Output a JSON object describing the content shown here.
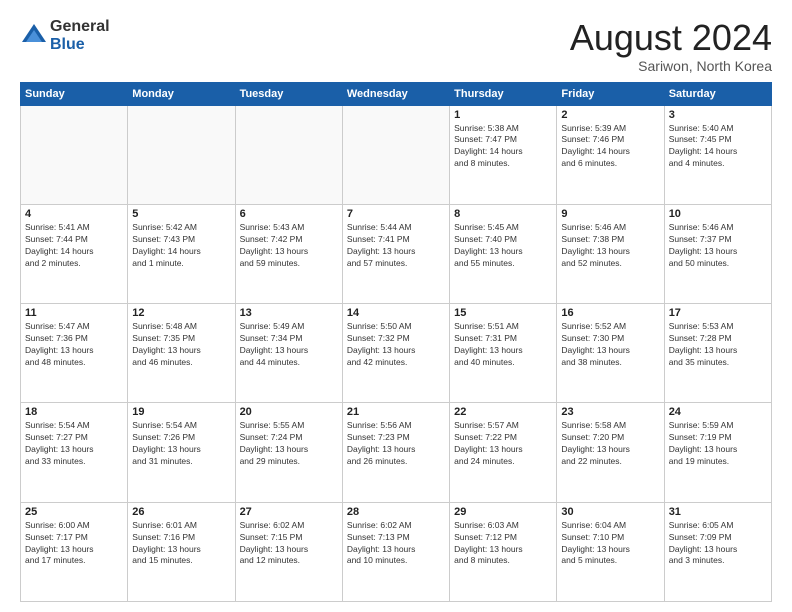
{
  "header": {
    "logo_general": "General",
    "logo_blue": "Blue",
    "month_title": "August 2024",
    "subtitle": "Sariwon, North Korea"
  },
  "days_of_week": [
    "Sunday",
    "Monday",
    "Tuesday",
    "Wednesday",
    "Thursday",
    "Friday",
    "Saturday"
  ],
  "weeks": [
    [
      {
        "day": "",
        "content": ""
      },
      {
        "day": "",
        "content": ""
      },
      {
        "day": "",
        "content": ""
      },
      {
        "day": "",
        "content": ""
      },
      {
        "day": "1",
        "content": "Sunrise: 5:38 AM\nSunset: 7:47 PM\nDaylight: 14 hours\nand 8 minutes."
      },
      {
        "day": "2",
        "content": "Sunrise: 5:39 AM\nSunset: 7:46 PM\nDaylight: 14 hours\nand 6 minutes."
      },
      {
        "day": "3",
        "content": "Sunrise: 5:40 AM\nSunset: 7:45 PM\nDaylight: 14 hours\nand 4 minutes."
      }
    ],
    [
      {
        "day": "4",
        "content": "Sunrise: 5:41 AM\nSunset: 7:44 PM\nDaylight: 14 hours\nand 2 minutes."
      },
      {
        "day": "5",
        "content": "Sunrise: 5:42 AM\nSunset: 7:43 PM\nDaylight: 14 hours\nand 1 minute."
      },
      {
        "day": "6",
        "content": "Sunrise: 5:43 AM\nSunset: 7:42 PM\nDaylight: 13 hours\nand 59 minutes."
      },
      {
        "day": "7",
        "content": "Sunrise: 5:44 AM\nSunset: 7:41 PM\nDaylight: 13 hours\nand 57 minutes."
      },
      {
        "day": "8",
        "content": "Sunrise: 5:45 AM\nSunset: 7:40 PM\nDaylight: 13 hours\nand 55 minutes."
      },
      {
        "day": "9",
        "content": "Sunrise: 5:46 AM\nSunset: 7:38 PM\nDaylight: 13 hours\nand 52 minutes."
      },
      {
        "day": "10",
        "content": "Sunrise: 5:46 AM\nSunset: 7:37 PM\nDaylight: 13 hours\nand 50 minutes."
      }
    ],
    [
      {
        "day": "11",
        "content": "Sunrise: 5:47 AM\nSunset: 7:36 PM\nDaylight: 13 hours\nand 48 minutes."
      },
      {
        "day": "12",
        "content": "Sunrise: 5:48 AM\nSunset: 7:35 PM\nDaylight: 13 hours\nand 46 minutes."
      },
      {
        "day": "13",
        "content": "Sunrise: 5:49 AM\nSunset: 7:34 PM\nDaylight: 13 hours\nand 44 minutes."
      },
      {
        "day": "14",
        "content": "Sunrise: 5:50 AM\nSunset: 7:32 PM\nDaylight: 13 hours\nand 42 minutes."
      },
      {
        "day": "15",
        "content": "Sunrise: 5:51 AM\nSunset: 7:31 PM\nDaylight: 13 hours\nand 40 minutes."
      },
      {
        "day": "16",
        "content": "Sunrise: 5:52 AM\nSunset: 7:30 PM\nDaylight: 13 hours\nand 38 minutes."
      },
      {
        "day": "17",
        "content": "Sunrise: 5:53 AM\nSunset: 7:28 PM\nDaylight: 13 hours\nand 35 minutes."
      }
    ],
    [
      {
        "day": "18",
        "content": "Sunrise: 5:54 AM\nSunset: 7:27 PM\nDaylight: 13 hours\nand 33 minutes."
      },
      {
        "day": "19",
        "content": "Sunrise: 5:54 AM\nSunset: 7:26 PM\nDaylight: 13 hours\nand 31 minutes."
      },
      {
        "day": "20",
        "content": "Sunrise: 5:55 AM\nSunset: 7:24 PM\nDaylight: 13 hours\nand 29 minutes."
      },
      {
        "day": "21",
        "content": "Sunrise: 5:56 AM\nSunset: 7:23 PM\nDaylight: 13 hours\nand 26 minutes."
      },
      {
        "day": "22",
        "content": "Sunrise: 5:57 AM\nSunset: 7:22 PM\nDaylight: 13 hours\nand 24 minutes."
      },
      {
        "day": "23",
        "content": "Sunrise: 5:58 AM\nSunset: 7:20 PM\nDaylight: 13 hours\nand 22 minutes."
      },
      {
        "day": "24",
        "content": "Sunrise: 5:59 AM\nSunset: 7:19 PM\nDaylight: 13 hours\nand 19 minutes."
      }
    ],
    [
      {
        "day": "25",
        "content": "Sunrise: 6:00 AM\nSunset: 7:17 PM\nDaylight: 13 hours\nand 17 minutes."
      },
      {
        "day": "26",
        "content": "Sunrise: 6:01 AM\nSunset: 7:16 PM\nDaylight: 13 hours\nand 15 minutes."
      },
      {
        "day": "27",
        "content": "Sunrise: 6:02 AM\nSunset: 7:15 PM\nDaylight: 13 hours\nand 12 minutes."
      },
      {
        "day": "28",
        "content": "Sunrise: 6:02 AM\nSunset: 7:13 PM\nDaylight: 13 hours\nand 10 minutes."
      },
      {
        "day": "29",
        "content": "Sunrise: 6:03 AM\nSunset: 7:12 PM\nDaylight: 13 hours\nand 8 minutes."
      },
      {
        "day": "30",
        "content": "Sunrise: 6:04 AM\nSunset: 7:10 PM\nDaylight: 13 hours\nand 5 minutes."
      },
      {
        "day": "31",
        "content": "Sunrise: 6:05 AM\nSunset: 7:09 PM\nDaylight: 13 hours\nand 3 minutes."
      }
    ]
  ]
}
